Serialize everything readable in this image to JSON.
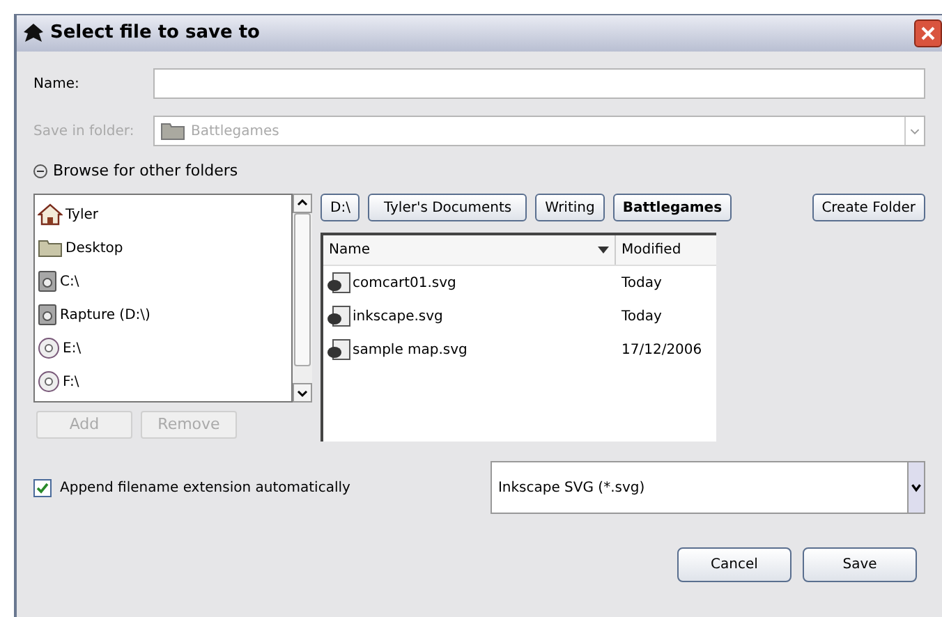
{
  "window": {
    "title": "Select file to save to"
  },
  "name_field": {
    "label": "Name:"
  },
  "save_in": {
    "label": "Save in folder:",
    "value": "Battlegames",
    "disabled": true
  },
  "browse": {
    "label": "Browse for other folders",
    "expanded": true
  },
  "places": [
    {
      "label": "Tyler",
      "kind": "home"
    },
    {
      "label": "Desktop",
      "kind": "folder"
    },
    {
      "label": "C:\\",
      "kind": "drive"
    },
    {
      "label": "Rapture (D:\\)",
      "kind": "drive"
    },
    {
      "label": "E:\\",
      "kind": "disc"
    },
    {
      "label": "F:\\",
      "kind": "disc"
    }
  ],
  "place_buttons": [
    {
      "label": "Add",
      "disabled": true
    },
    {
      "label": "Remove",
      "disabled": true
    }
  ],
  "path": [
    {
      "label": "D:\\",
      "selected": false
    },
    {
      "label": "Tyler's Documents",
      "selected": false
    },
    {
      "label": "Writing",
      "selected": false
    },
    {
      "label": "Battlegames",
      "selected": true
    }
  ],
  "create_folder": "Create Folder",
  "files": {
    "columns": [
      "Name",
      "Modified"
    ],
    "rows": [
      {
        "name": "comcart01.svg",
        "modified": "Today"
      },
      {
        "name": "inkscape.svg",
        "modified": "Today"
      },
      {
        "name": "sample map.svg",
        "modified": "17/12/2006"
      }
    ]
  },
  "append_extension": {
    "label": "Append filename extension automatically",
    "checked": true
  },
  "file_type": "Inkscape SVG (*.svg)",
  "buttons": [
    "Cancel",
    "Save"
  ]
}
